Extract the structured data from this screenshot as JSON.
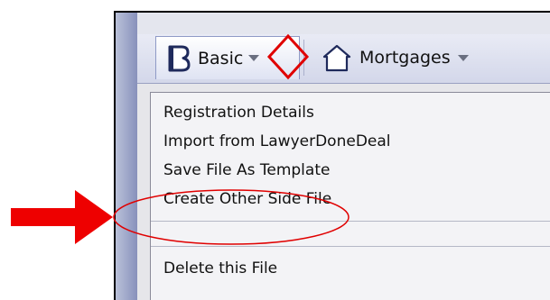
{
  "toolbar": {
    "basic_label": "Basic",
    "mortgages_label": "Mortgages"
  },
  "menu": {
    "items": [
      "Registration Details",
      "Import from LawyerDoneDeal",
      "Save File As Template",
      "Create Other Side File",
      "Delete this File"
    ]
  },
  "annotation_colors": {
    "highlight": "#e00000",
    "arrow": "#ee0000"
  },
  "icons": {
    "basic": "b-document-icon",
    "mortgages": "house-icon",
    "dropdown": "dropdown-caret-icon"
  }
}
